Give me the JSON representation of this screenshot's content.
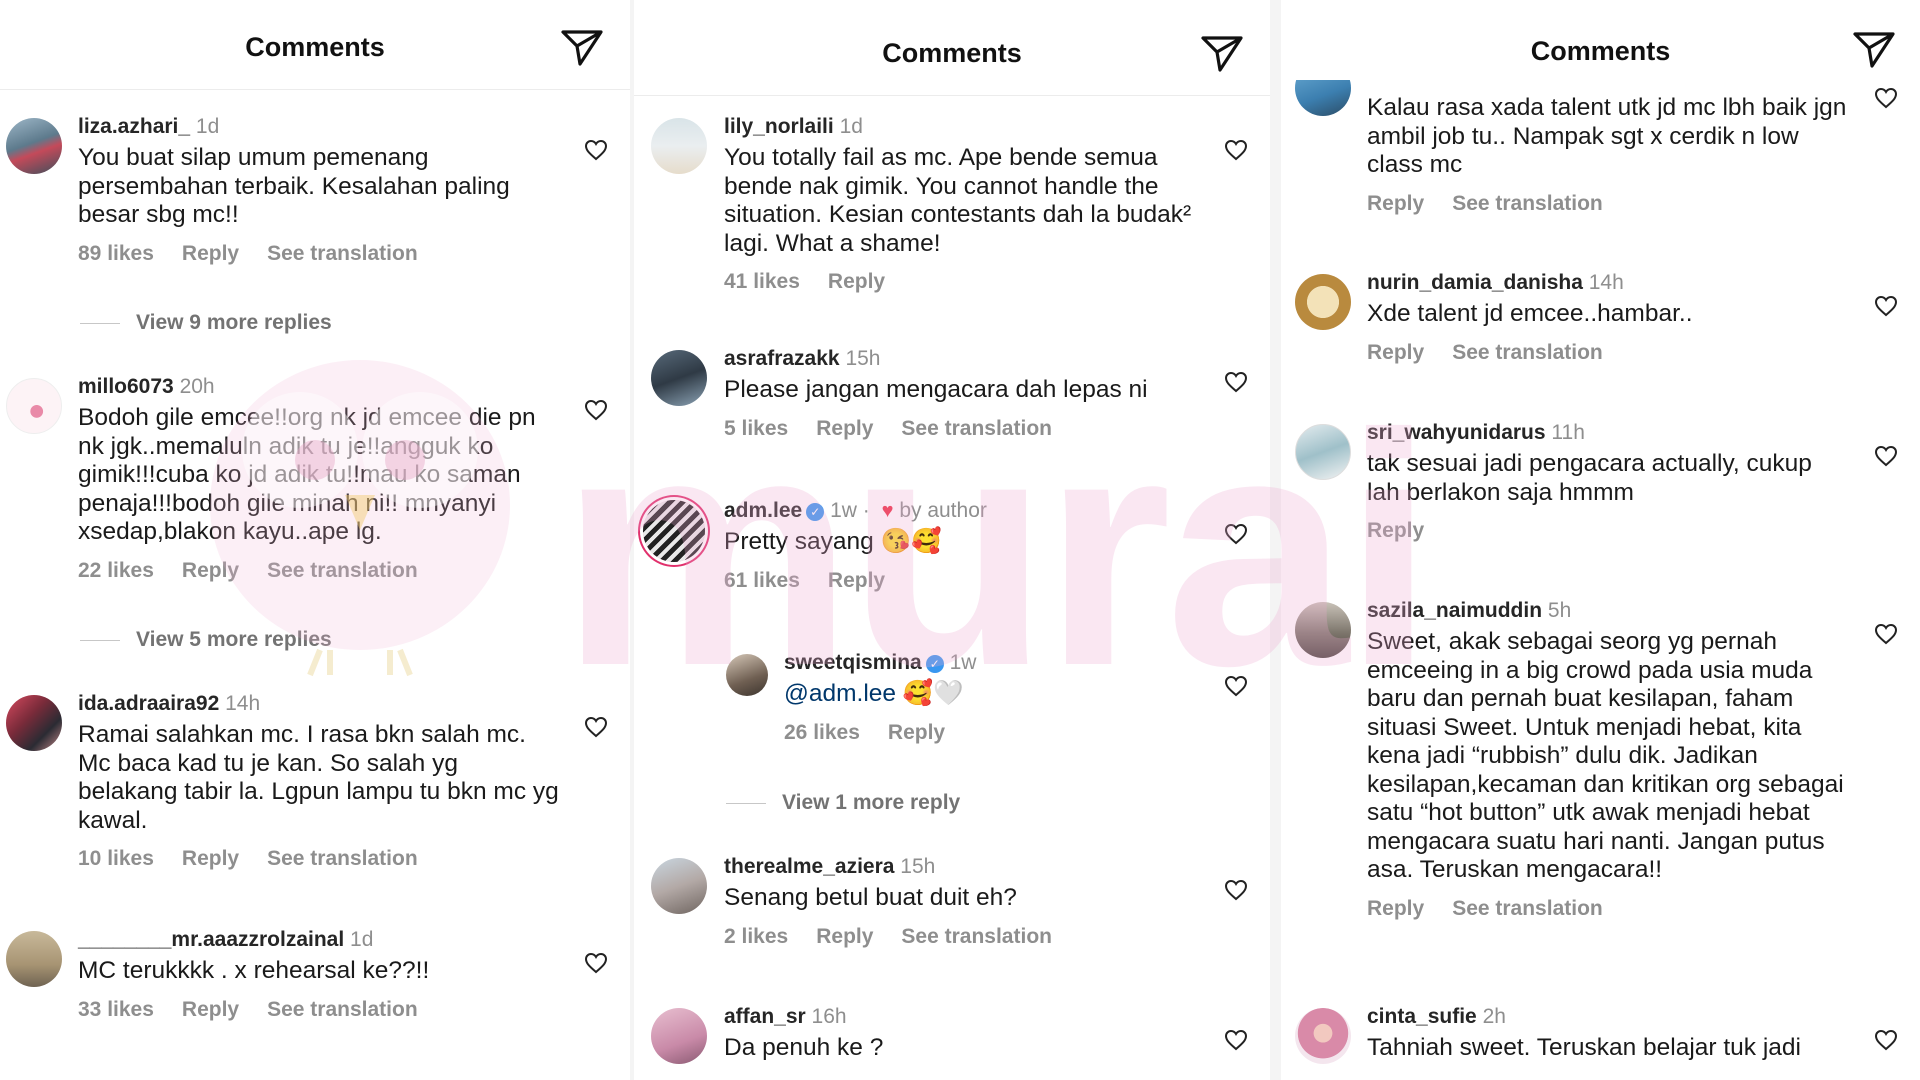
{
  "colors": {
    "accent_red": "#ed2d45",
    "verified": "#3897f0",
    "mention": "#00376b",
    "muted": "#8e8e8e",
    "watermark": "#f0b4d6"
  },
  "watermark_text": "murai",
  "panels": [
    {
      "title": "Comments",
      "send_icon": "send-icon",
      "comments": [
        {
          "user": "liza.azhari_",
          "time": "1d",
          "text": "You  buat silap umum pemenang persembahan terbaik. Kesalahan paling besar sbg mc!!",
          "likes": "89 likes",
          "reply": "Reply",
          "translate": "See translation",
          "view_more": "View 9 more replies"
        },
        {
          "user": "millo6073",
          "time": "20h",
          "text": "Bodoh gile emcee!!org nk jd emcee die pn nk jgk..memaluln adik tu je!!angguk ko gimik!!!cuba ko jd adik tu!!mau ko saman penaja!!!bodoh gile minah ni!! mnyanyi xsedap,blakon kayu..ape lg.",
          "likes": "22 likes",
          "reply": "Reply",
          "translate": "See translation",
          "view_more": "View 5 more replies"
        },
        {
          "user": "ida.adraaira92",
          "time": "14h",
          "text": "Ramai salahkan mc.  I rasa bkn salah mc.  Mc baca kad tu je kan.  So salah yg belakang tabir la.  Lgpun lampu tu bkn mc yg kawal.",
          "likes": "10 likes",
          "reply": "Reply",
          "translate": "See translation"
        },
        {
          "user": "________mr.aaazzrolzainal",
          "time": "1d",
          "text": "MC terukkkk . x rehearsal ke??!!",
          "likes": "33 likes",
          "reply": "Reply",
          "translate": "See translation"
        }
      ]
    },
    {
      "title": "Comments",
      "send_icon": "send-icon",
      "comments": [
        {
          "user": "lily_norlaili",
          "time": "1d",
          "text": "You totally fail as mc. Ape bende semua bende nak gimik. You cannot handle the situation. Kesian contestants dah la budak² lagi. What a shame!",
          "likes": "41 likes",
          "reply": "Reply"
        },
        {
          "user": "asrafrazakk",
          "time": "15h",
          "text": "Please jangan mengacara dah lepas ni",
          "likes": "5 likes",
          "reply": "Reply",
          "translate": "See translation"
        },
        {
          "user": "adm.lee",
          "time": "1w",
          "verified": true,
          "by_author": "by author",
          "text": "Pretty sayang 😘🥰",
          "likes": "61 likes",
          "reply": "Reply"
        },
        {
          "user": "sweetqismina",
          "time": "1w",
          "verified": true,
          "mention": "@adm.lee",
          "text": " 🥰🤍",
          "likes": "26 likes",
          "reply": "Reply",
          "view_more": "View 1 more reply"
        },
        {
          "user": "therealme_aziera",
          "time": "15h",
          "text": "Senang betul buat duit eh?",
          "likes": "2 likes",
          "reply": "Reply",
          "translate": "See translation"
        },
        {
          "user": "affan_sr",
          "time": "16h",
          "text": "Da penuh ke ?"
        }
      ]
    },
    {
      "title": "Comments",
      "send_icon": "send-icon",
      "comments": [
        {
          "user": "",
          "time": "",
          "text": "Kalau rasa xada talent utk jd mc lbh baik jgn ambil job tu.. Nampak sgt x cerdik n low class mc",
          "reply": "Reply",
          "translate": "See translation"
        },
        {
          "user": "nurin_damia_danisha",
          "time": "14h",
          "text": "Xde talent jd emcee..hambar..",
          "reply": "Reply",
          "translate": "See translation"
        },
        {
          "user": "sri_wahyunidarus",
          "time": "11h",
          "text": "tak sesuai jadi pengacara actually, cukup lah berlakon saja hmmm",
          "reply": "Reply"
        },
        {
          "user": "sazila_naimuddin",
          "time": "5h",
          "text": "Sweet, akak sebagai seorg yg pernah emceeing in a big crowd pada usia muda baru dan pernah buat kesilapan, faham situasi Sweet. Untuk menjadi hebat, kita kena jadi “rubbish” dulu dik. Jadikan kesilapan,kecaman dan kritikan org sebagai satu “hot button” utk awak menjadi hebat mengacara suatu hari nanti. Jangan putus asa. Teruskan mengacara!!",
          "reply": "Reply",
          "translate": "See translation"
        },
        {
          "user": "cinta_sufie",
          "time": "2h",
          "text": "Tahniah sweet. Teruskan belajar tuk jadi"
        }
      ]
    }
  ]
}
